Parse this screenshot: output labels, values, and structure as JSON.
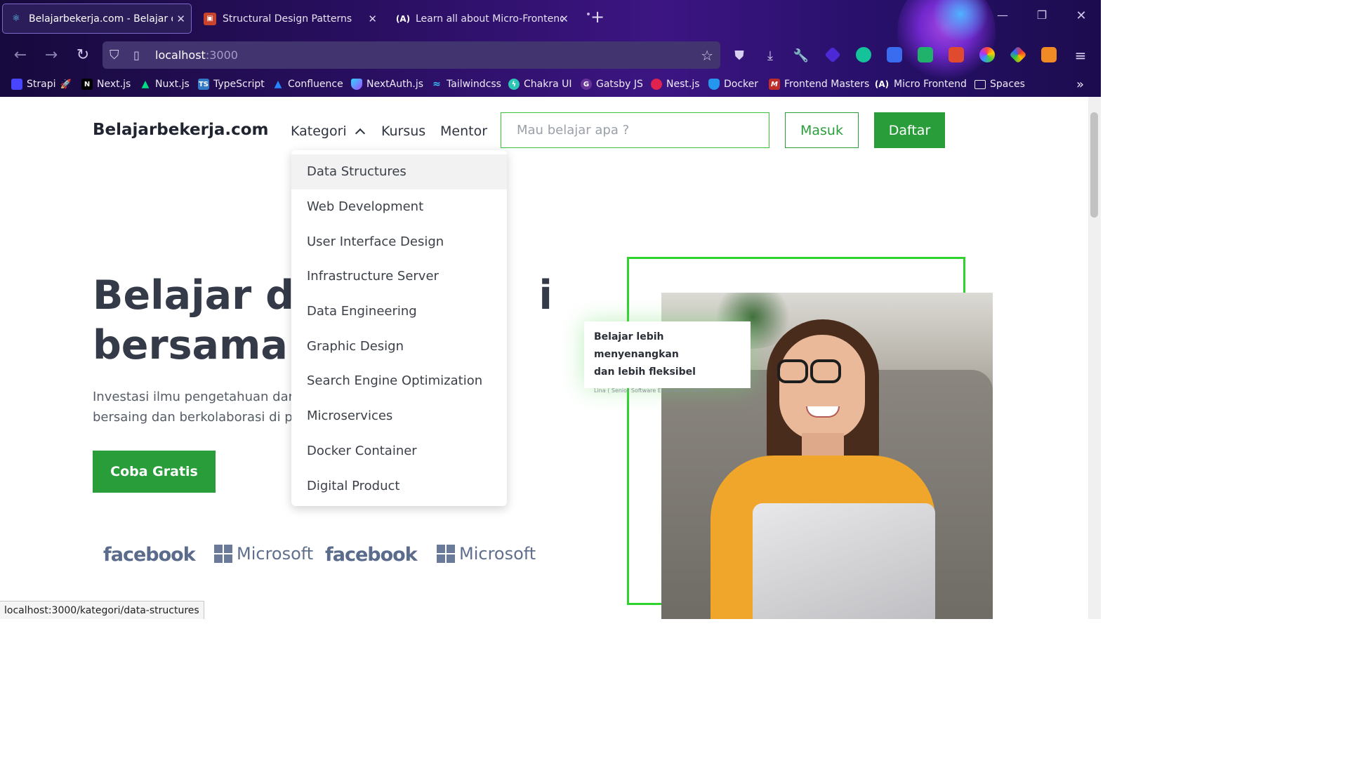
{
  "browser": {
    "tabs": [
      {
        "title": "Belajarbekerja.com - Belajar dengan Mentor",
        "active": true,
        "icon": "react-icon"
      },
      {
        "title": "Structural Design Patterns",
        "active": false,
        "icon": "refactoring-guru-icon"
      },
      {
        "title": "Learn all about Micro-Frontends",
        "active": false,
        "icon": "micro-frontend-icon"
      }
    ],
    "url_host": "localhost",
    "url_port": ":3000",
    "bookmarks": [
      {
        "label": "Strapi",
        "icon": "strapi-icon",
        "color": "#4945ff"
      },
      {
        "label": "Next.js",
        "icon": "nextjs-icon",
        "color": "#000000"
      },
      {
        "label": "Nuxt.js",
        "icon": "nuxt-icon",
        "color": "#00dc82"
      },
      {
        "label": "TypeScript",
        "icon": "typescript-icon",
        "color": "#3178c6"
      },
      {
        "label": "Confluence",
        "icon": "confluence-icon",
        "color": "#1868db"
      },
      {
        "label": "NextAuth.js",
        "icon": "nextauth-icon",
        "color": "#7b3fe4"
      },
      {
        "label": "Tailwindcss",
        "icon": "tailwind-icon",
        "color": "#38bdf8"
      },
      {
        "label": "Chakra UI",
        "icon": "chakra-icon",
        "color": "#2ec4b6"
      },
      {
        "label": "Gatsby JS",
        "icon": "gatsby-icon",
        "color": "#663399"
      },
      {
        "label": "Nest.js",
        "icon": "nestjs-icon",
        "color": "#e0234e"
      },
      {
        "label": "Docker",
        "icon": "docker-icon",
        "color": "#2496ed"
      },
      {
        "label": "Frontend Masters",
        "icon": "frontend-masters-icon",
        "color": "#c02d28"
      },
      {
        "label": "Micro Frontend",
        "icon": "micro-frontend-icon",
        "color": "#ffffff"
      },
      {
        "label": "Spaces",
        "icon": "folder-icon",
        "color": "#ffffff"
      }
    ],
    "status_url": "localhost:3000/kategori/data-structures"
  },
  "site": {
    "logo": "Belajarbekerja.com",
    "nav": {
      "kategori": "Kategori",
      "kursus": "Kursus",
      "mentor": "Mentor"
    },
    "search_placeholder": "Mau belajar apa ?",
    "masuk": "Masuk",
    "daftar": "Daftar",
    "accent": "#2a9d3b"
  },
  "dropdown": {
    "items": [
      "Data Structures",
      "Web Development",
      "User Interface Design",
      "Infrastructure Server",
      "Data Engineering",
      "Graphic Design",
      "Search Engine Optimization",
      "Microservices",
      "Docker Container",
      "Digital Product"
    ],
    "highlighted_index": 0
  },
  "hero": {
    "line1_a": "Belajar da",
    "line1_b": "i",
    "line2": "bersama M",
    "desc1": "Investasi ilmu pengetahuan dan",
    "desc2": "bersaing dan berkolaborasi di p",
    "cta": "Coba Gratis"
  },
  "brands": [
    "facebook",
    "Microsoft",
    "facebook",
    "Microsoft"
  ],
  "testimonial": {
    "quote_line1": "Belajar lebih menyenangkan",
    "quote_line2": "dan lebih fleksibel",
    "author": "Lina ( Senior Software Engineer at Airbnb )"
  }
}
